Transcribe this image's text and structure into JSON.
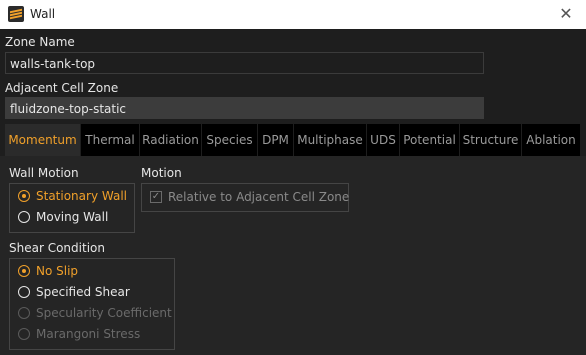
{
  "window": {
    "title": "Wall",
    "close_glyph": "✕",
    "app_icon": "fluent-app-icon"
  },
  "zone_name": {
    "label": "Zone Name",
    "value": "walls-tank-top"
  },
  "adjacent_cell_zone": {
    "label": "Adjacent Cell Zone",
    "value": "fluidzone-top-static"
  },
  "tabs": [
    {
      "label": "Momentum",
      "active": true
    },
    {
      "label": "Thermal"
    },
    {
      "label": "Radiation"
    },
    {
      "label": "Species"
    },
    {
      "label": "DPM"
    },
    {
      "label": "Multiphase"
    },
    {
      "label": "UDS"
    },
    {
      "label": "Potential"
    },
    {
      "label": "Structure"
    },
    {
      "label": "Ablation"
    }
  ],
  "wall_motion": {
    "label": "Wall Motion",
    "options": [
      {
        "label": "Stationary Wall",
        "selected": true
      },
      {
        "label": "Moving Wall",
        "selected": false
      }
    ]
  },
  "motion": {
    "label": "Motion",
    "relative_checkbox": {
      "label": "Relative to Adjacent Cell Zone",
      "checked": true,
      "enabled": false
    }
  },
  "shear_condition": {
    "label": "Shear Condition",
    "options": [
      {
        "label": "No Slip",
        "selected": true,
        "enabled": true
      },
      {
        "label": "Specified Shear",
        "selected": false,
        "enabled": true
      },
      {
        "label": "Specularity Coefficient",
        "selected": false,
        "enabled": false
      },
      {
        "label": "Marangoni Stress",
        "selected": false,
        "enabled": false
      }
    ]
  },
  "colors": {
    "accent": "#f0a02a",
    "background": "#1e1e1e",
    "panel": "#252525",
    "tab_bar": "#000000"
  }
}
